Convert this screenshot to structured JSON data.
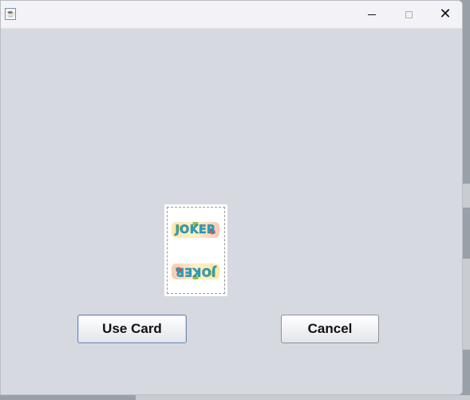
{
  "window": {
    "title": "",
    "controls": {
      "minimize": "minimize",
      "maximize": "maximize",
      "close": "✕"
    }
  },
  "card": {
    "name": "Joker",
    "top_label": "JOKER",
    "bottom_label": "JOKER"
  },
  "buttons": {
    "use_label": "Use Card",
    "cancel_label": "Cancel"
  }
}
